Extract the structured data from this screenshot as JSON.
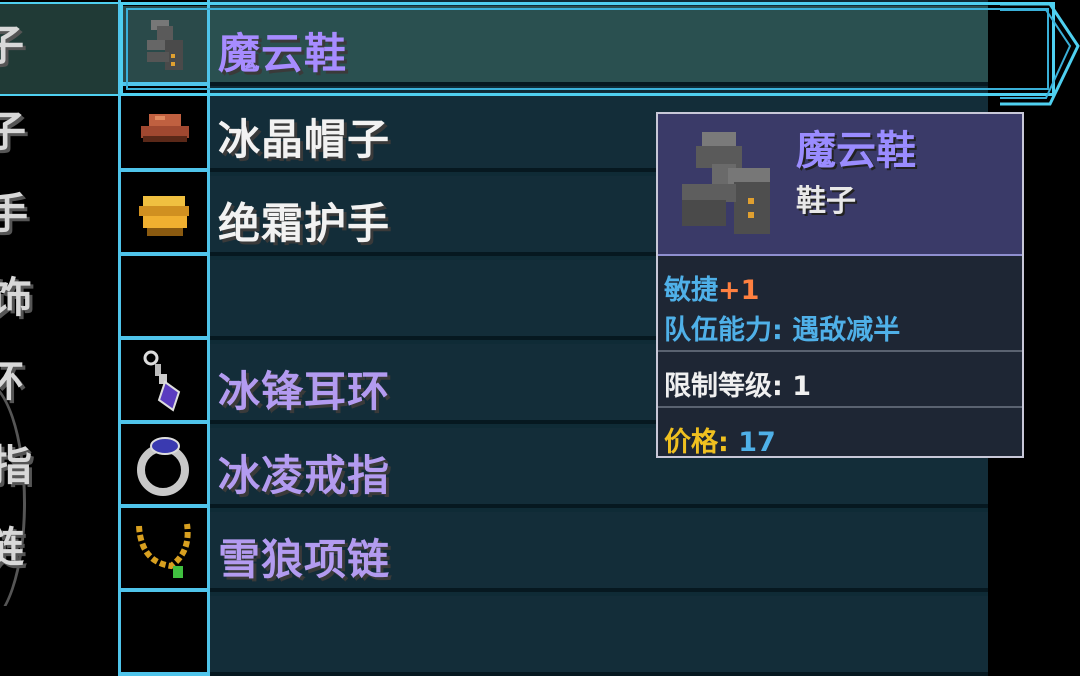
{
  "categories": [
    "鞋子",
    "帽子",
    "护手",
    "饰",
    "耳环",
    "戒指",
    "项链"
  ],
  "visible_category_fragments": [
    "子",
    "子",
    "手",
    "饰",
    "环",
    "指",
    "链"
  ],
  "items": [
    {
      "name": "魔云鞋",
      "color": "#a78cff",
      "icon": "boots-icon",
      "selected": true
    },
    {
      "name": "冰晶帽子",
      "color": "#f2f2f2",
      "icon": "hat-icon"
    },
    {
      "name": "绝霜护手",
      "color": "#f2f2f2",
      "icon": "gauntlet-icon"
    },
    {
      "name": "",
      "color": "#f2f2f2",
      "icon": ""
    },
    {
      "name": "冰锋耳环",
      "color": "#b39bf0",
      "icon": "earring-icon"
    },
    {
      "name": "冰凌戒指",
      "color": "#b39bf0",
      "icon": "ring-icon"
    },
    {
      "name": "雪狼项链",
      "color": "#b39bf0",
      "icon": "necklace-icon"
    }
  ],
  "tooltip": {
    "title": "魔云鞋",
    "type": "鞋子",
    "stat_label": "敏捷",
    "stat_value": "+1",
    "team_ability": "队伍能力: 遇敌减半",
    "level_label": "限制等级:",
    "level_value": "1",
    "price_label": "价格:",
    "price_value": "17"
  },
  "colors": {
    "accent": "#4fc4ea",
    "stat": "#4fb0e8",
    "bonus": "#ff8040",
    "price_label": "#f0c020"
  }
}
